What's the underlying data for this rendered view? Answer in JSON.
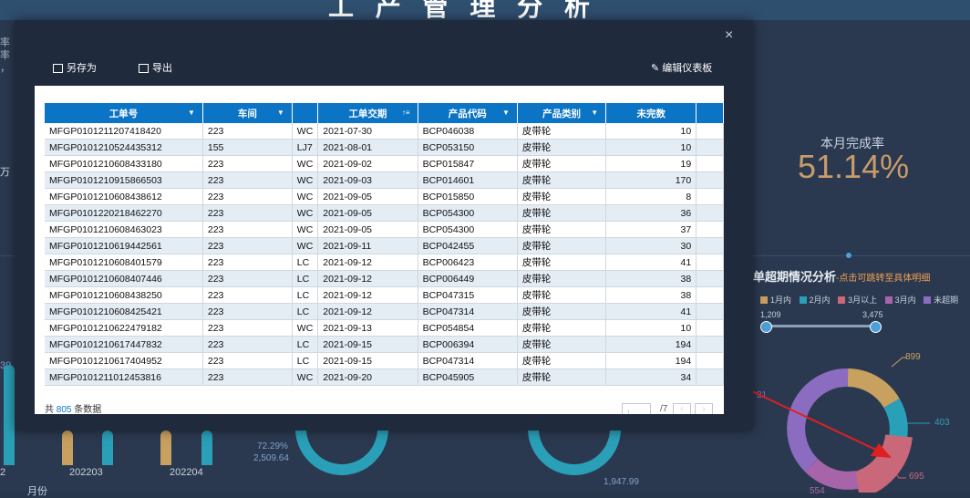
{
  "background": {
    "title": "工 产 管 理 分 析",
    "left_fragment_lines": [
      "率",
      "率",
      "，"
    ],
    "left_unit": "万",
    "rate_label": "本月完成率",
    "rate_value": "51.14%",
    "overdue_title": "单超期情况分析",
    "overdue_subtitle": "-点击可跳转至具体明细",
    "legend": [
      {
        "label": "1月内",
        "color": "#c8a060"
      },
      {
        "label": "2月内",
        "color": "#2aa0b8"
      },
      {
        "label": "3月以上",
        "color": "#c86878"
      },
      {
        "label": "3月内",
        "color": "#a864a8"
      },
      {
        "label": "未超期",
        "color": "#8c6cc0"
      }
    ],
    "slider_min": "1,209",
    "slider_max": "3,475",
    "donut_labels": {
      "a": "899",
      "b": "403",
      "c": "695",
      "d": "554",
      "e": "21"
    },
    "bottom_labels": {
      "p1": "2",
      "p2": "202203",
      "p3": "202204",
      "month": "月份",
      "pct": "72.29%",
      "val": "2,509.64",
      "v2": "1,947.99",
      "left_num": "39."
    }
  },
  "modal": {
    "save_as": "另存为",
    "export": "导出",
    "edit_dashboard": "编辑仪表板",
    "close": "×"
  },
  "table": {
    "headers": [
      "工单号",
      "车间",
      "",
      "工单交期",
      "产品代码",
      "产品类别",
      "未完数"
    ],
    "rows": [
      [
        "MFGP0101211207418420",
        "223",
        "WC",
        "2021-07-30",
        "BCP046038",
        "皮带轮",
        "10"
      ],
      [
        "MFGP0101210524435312",
        "155",
        "LJ7",
        "2021-08-01",
        "BCP053150",
        "皮带轮",
        "10"
      ],
      [
        "MFGP0101210608433180",
        "223",
        "WC",
        "2021-09-02",
        "BCP015847",
        "皮带轮",
        "19"
      ],
      [
        "MFGP0101210915866503",
        "223",
        "WC",
        "2021-09-03",
        "BCP014601",
        "皮带轮",
        "170"
      ],
      [
        "MFGP0101210608438612",
        "223",
        "WC",
        "2021-09-05",
        "BCP015850",
        "皮带轮",
        "8"
      ],
      [
        "MFGP0101220218462270",
        "223",
        "WC",
        "2021-09-05",
        "BCP054300",
        "皮带轮",
        "36"
      ],
      [
        "MFGP0101210608463023",
        "223",
        "WC",
        "2021-09-05",
        "BCP054300",
        "皮带轮",
        "37"
      ],
      [
        "MFGP0101210619442561",
        "223",
        "WC",
        "2021-09-11",
        "BCP042455",
        "皮带轮",
        "30"
      ],
      [
        "MFGP0101210608401579",
        "223",
        "LC",
        "2021-09-12",
        "BCP006423",
        "皮带轮",
        "41"
      ],
      [
        "MFGP0101210608407446",
        "223",
        "LC",
        "2021-09-12",
        "BCP006449",
        "皮带轮",
        "38"
      ],
      [
        "MFGP0101210608438250",
        "223",
        "LC",
        "2021-09-12",
        "BCP047315",
        "皮带轮",
        "38"
      ],
      [
        "MFGP0101210608425421",
        "223",
        "LC",
        "2021-09-12",
        "BCP047314",
        "皮带轮",
        "41"
      ],
      [
        "MFGP0101210622479182",
        "223",
        "WC",
        "2021-09-13",
        "BCP054854",
        "皮带轮",
        "10"
      ],
      [
        "MFGP0101210617447832",
        "223",
        "LC",
        "2021-09-15",
        "BCP006394",
        "皮带轮",
        "194"
      ],
      [
        "MFGP0101210617404952",
        "223",
        "LC",
        "2021-09-15",
        "BCP047314",
        "皮带轮",
        "194"
      ],
      [
        "MFGP0101211012453816",
        "223",
        "WC",
        "2021-09-20",
        "BCP045905",
        "皮带轮",
        "34"
      ]
    ],
    "footer_prefix": "共",
    "footer_count": "805",
    "footer_suffix": "条数据",
    "page_current": "1",
    "page_total": "/7"
  }
}
